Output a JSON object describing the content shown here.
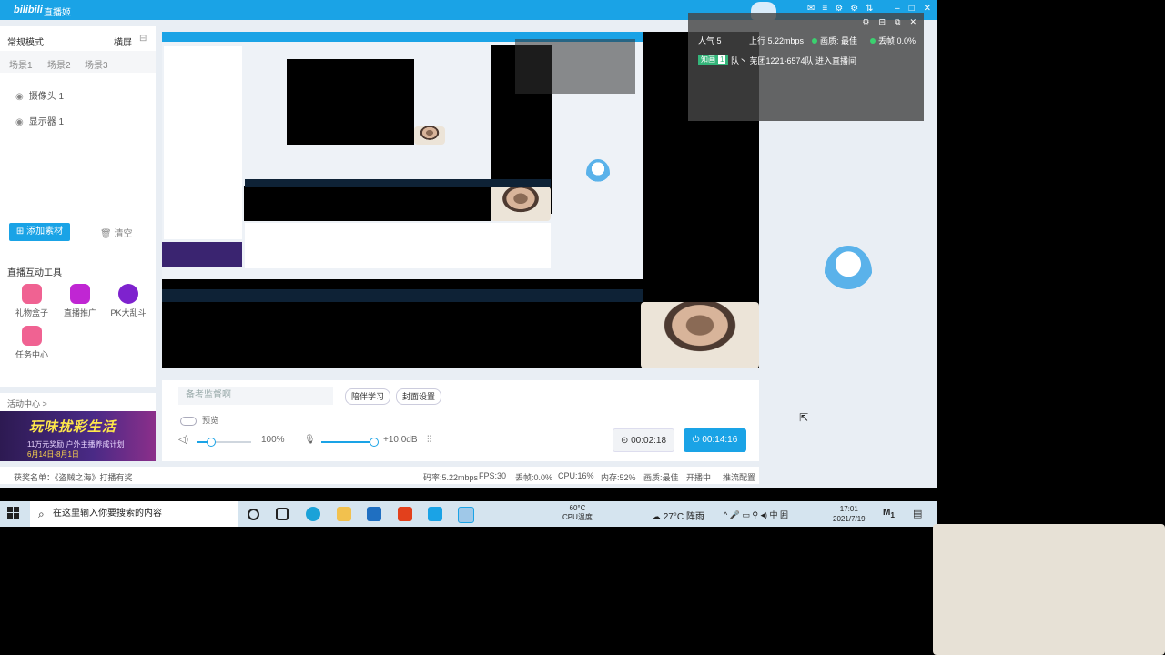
{
  "titlebar": {
    "logo": "bilibili",
    "title": "直播姬",
    "controls": [
      "✉",
      "≡",
      "⚙",
      "⚙",
      "⇅"
    ],
    "window": [
      "–",
      "□",
      "✕"
    ]
  },
  "left": {
    "mode": "常规模式",
    "landscape": "横屏",
    "scenes": [
      "场景1",
      "场景2",
      "场景3"
    ],
    "sources": [
      "摄像头 1",
      "显示器 1"
    ],
    "add_btn": "添加素材",
    "clear_btn": "清空"
  },
  "tools": {
    "title": "直播互动工具",
    "items": [
      {
        "label": "礼物盒子",
        "icon": "gift-box-icon",
        "color": "#f06292"
      },
      {
        "label": "直播推广",
        "icon": "promotion-icon",
        "color": "#c026d3"
      },
      {
        "label": "PK大乱斗",
        "icon": "pk-icon",
        "color": "#7e22ce"
      },
      {
        "label": "任务中心",
        "icon": "task-center-icon",
        "color": "#f06292"
      }
    ]
  },
  "activity": {
    "title": "活动中心 >",
    "banner_title": "玩味扰彩生活",
    "banner_sub": "11万元奖励  户外主播养成计划",
    "banner_date": "6月14日-8月1日"
  },
  "controls": {
    "announcement_placeholder": "备考监督啊",
    "pill1": "陪伴学习",
    "pill2": "封面设置",
    "preview": "预览",
    "volume": "100%",
    "mic_gain": "+10.0dB",
    "volume_level": 0.25,
    "mic_level": 1.0,
    "record_time": "00:02:18",
    "live_time": "00:14:16"
  },
  "statusbar": {
    "award": "获奖名单：《盗贼之海》打播有奖",
    "bitrate": "码率:5.22mbps",
    "fps": "FPS:30",
    "drop": "丢帧:0.0%",
    "cpu": "CPU:16%",
    "mem": "内存:52%",
    "quality": "画质:最佳",
    "state": "开播中",
    "hint": "推流配置"
  },
  "overlay": {
    "popular": "人气  5",
    "upload": "上行  5.22mbps",
    "quality": "画质: 最佳",
    "drop": "丢帧 0.0%",
    "badge": "知画",
    "badge_level": "1",
    "enter": "队丶 芜团1221-6574队 进入直播间"
  },
  "taskbar": {
    "search": "在这里输入你要搜索的内容",
    "cpu_temp": "60°C",
    "cpu_label": "CPU温度",
    "weather": "27°C  阵雨",
    "tray": "^  🎤  ▭  ⚲  ◂)  中  囲",
    "time": "17:01",
    "date": "2021/7/19",
    "right": "M",
    "right_badge": "1"
  }
}
